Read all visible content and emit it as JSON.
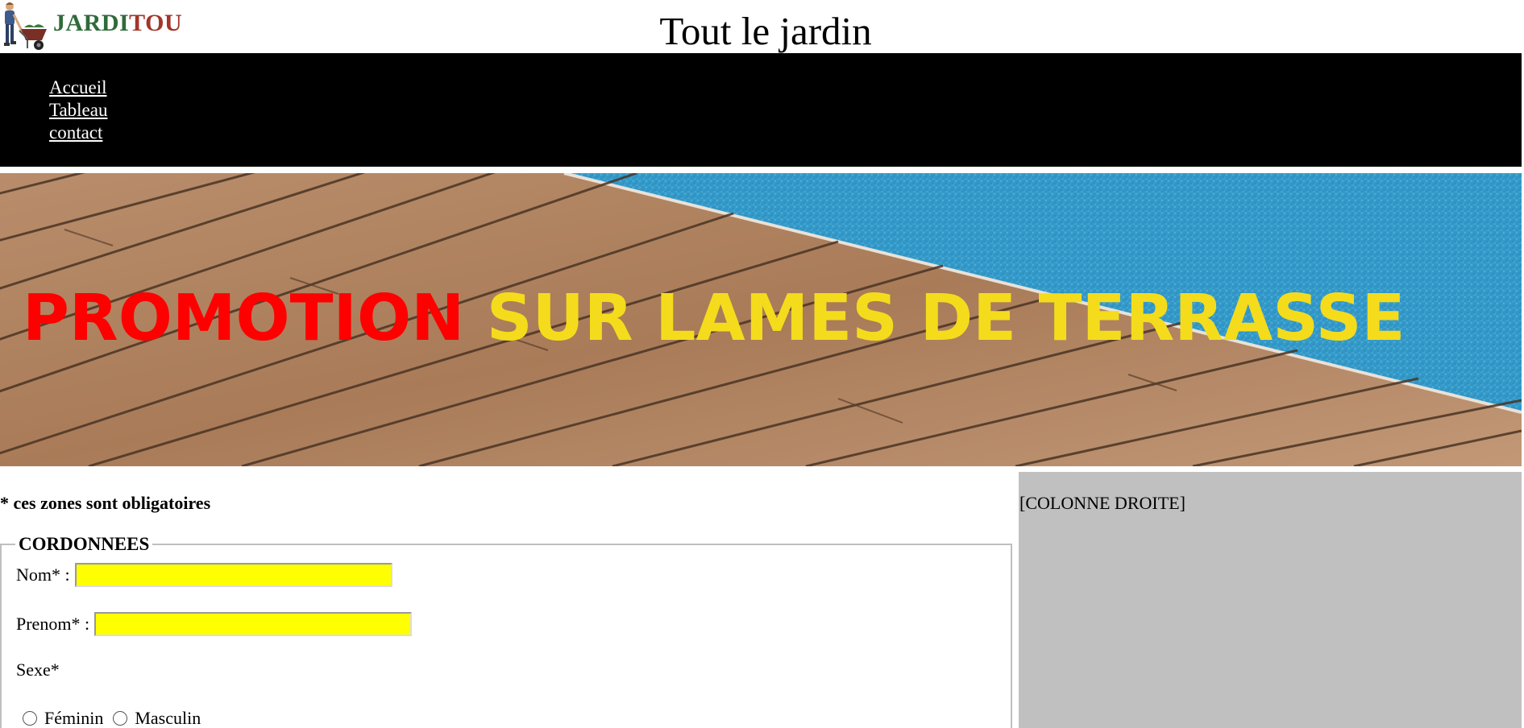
{
  "header": {
    "logo_text_part1": "JARDI",
    "logo_text_part2": "TOU",
    "title": "Tout le jardin"
  },
  "nav": {
    "items": [
      {
        "label": "Accueil"
      },
      {
        "label": "Tableau"
      },
      {
        "label": "contact"
      }
    ]
  },
  "banner": {
    "text_red": "PROMOTION",
    "text_yellow": "SUR LAMES DE TERRASSE"
  },
  "form": {
    "required_note": "* ces zones sont obligatoires",
    "legend": "CORDONNEES",
    "nom_label": "Nom* :",
    "nom_value": "",
    "prenom_label": "Prenom* :",
    "prenom_value": "",
    "sexe_label": "Sexe*",
    "option_feminin": "Féminin",
    "option_masculin": "Masculin"
  },
  "right_column": {
    "label": "[COLONNE DROITE]"
  },
  "colors": {
    "nav_bg": "#000000",
    "input_bg": "#ffff00",
    "right_col_bg": "#c0c0c0",
    "logo_green": "#2f6b3a",
    "logo_red": "#a3352a",
    "promo_red": "#ff0000",
    "promo_yellow": "#f4dc1c"
  }
}
